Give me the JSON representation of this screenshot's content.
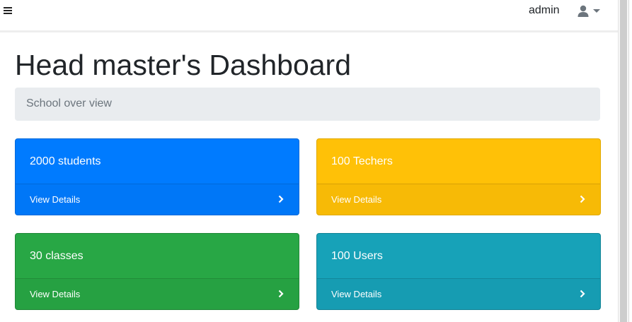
{
  "topbar": {
    "menu_icon": "hamburger-menu-icon",
    "user_name": "admin",
    "user_icon": "user-icon",
    "caret_icon": "caret-down-icon"
  },
  "main": {
    "title": "Head master's Dashboard",
    "breadcrumb": "School over view"
  },
  "cards": [
    {
      "text": "2000 students",
      "footer": "View Details",
      "color": "#007bff",
      "icon": "chevron-right-icon"
    },
    {
      "text": "100 Techers",
      "footer": "View Details",
      "color": "#ffc107",
      "icon": "chevron-right-icon"
    },
    {
      "text": "30 classes",
      "footer": "View Details",
      "color": "#28a745",
      "icon": "chevron-right-icon"
    },
    {
      "text": "100 Users",
      "footer": "View Details",
      "color": "#17a2b8",
      "icon": "chevron-right-icon"
    }
  ]
}
